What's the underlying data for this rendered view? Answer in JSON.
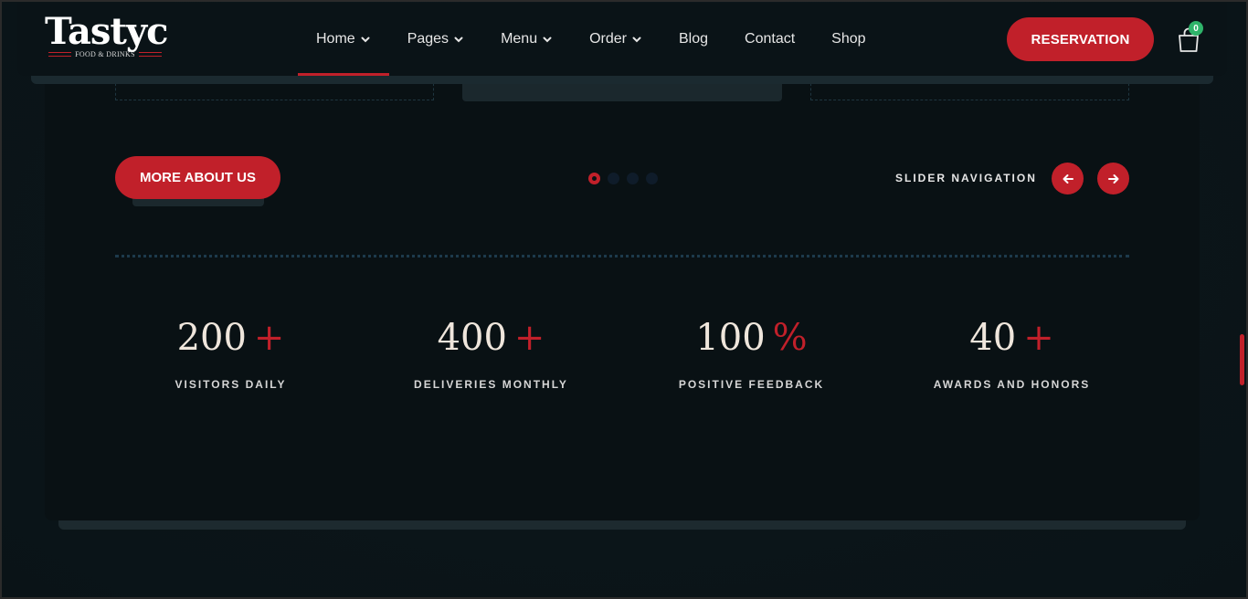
{
  "logo": {
    "name": "Tastyc",
    "tagline": "FOOD & DRINKS"
  },
  "nav": {
    "items": [
      {
        "label": "Home",
        "has_dropdown": true,
        "active": true
      },
      {
        "label": "Pages",
        "has_dropdown": true
      },
      {
        "label": "Menu",
        "has_dropdown": true
      },
      {
        "label": "Order",
        "has_dropdown": true
      },
      {
        "label": "Blog",
        "has_dropdown": false
      },
      {
        "label": "Contact",
        "has_dropdown": false
      },
      {
        "label": "Shop",
        "has_dropdown": false
      }
    ]
  },
  "header": {
    "reservation_label": "RESERVATION",
    "cart_count": "0",
    "cart_icon": "shopping-bag-icon"
  },
  "controls": {
    "more_label": "MORE ABOUT US",
    "slider_label": "SLIDER NAVIGATION",
    "prev_icon": "arrow-left-icon",
    "next_icon": "arrow-right-icon",
    "pagination": {
      "count": 4,
      "active_index": 0
    }
  },
  "stats": [
    {
      "value": "200",
      "suffix": "+",
      "label": "VISITORS DAILY"
    },
    {
      "value": "400",
      "suffix": "+",
      "label": "DELIVERIES MONTHLY"
    },
    {
      "value": "100",
      "suffix": "%",
      "label": "POSITIVE FEEDBACK"
    },
    {
      "value": "40",
      "suffix": "+",
      "label": "AWARDS AND HONORS"
    }
  ],
  "colors": {
    "accent": "#c1202a",
    "background": "#091114",
    "badge": "#2fb46a"
  }
}
